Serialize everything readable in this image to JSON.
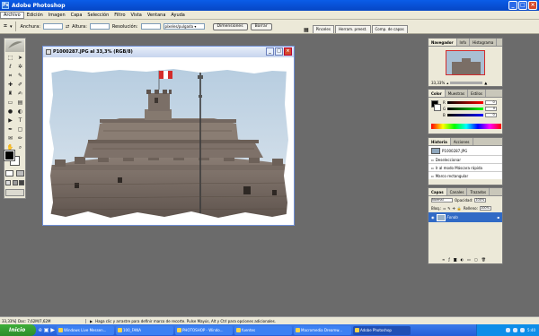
{
  "app": {
    "title": "Adobe Photoshop",
    "icon": "Ps"
  },
  "menu": [
    "Archivo",
    "Edición",
    "Imagen",
    "Capa",
    "Selección",
    "Filtro",
    "Vista",
    "Ventana",
    "Ayuda"
  ],
  "options": {
    "width_label": "Anchura:",
    "height_label": "Altura:",
    "resolution_label": "Resolución:",
    "units_select": "píxeles/pulgada",
    "front_image_button": "Dimensiones",
    "clear_button": "Borrar"
  },
  "palette_well": [
    "Pinceles",
    "Herram. preest.",
    "Comp. de capas"
  ],
  "document": {
    "title": "P1000287.JPG al 33,3% (RGB/8)"
  },
  "navigator": {
    "tabs": [
      "Navegador",
      "Info",
      "Histograma"
    ],
    "zoom": "33,33%"
  },
  "color": {
    "tabs": [
      "Color",
      "Muestras",
      "Estilos"
    ],
    "channels": [
      {
        "label": "R",
        "value": "0"
      },
      {
        "label": "G",
        "value": "0"
      },
      {
        "label": "B",
        "value": "0"
      }
    ]
  },
  "history": {
    "tabs": [
      "Historia",
      "Acciones"
    ],
    "snapshot": "P1000287.JPG",
    "steps": [
      "Deseleccionar",
      "Ir al modo Máscara rápida",
      "Marco rectangular"
    ]
  },
  "layers": {
    "tabs": [
      "Capas",
      "Canales",
      "Trazados"
    ],
    "blend_mode": "Normal",
    "opacity_label": "Opacidad:",
    "opacity": "100%",
    "lock_label": "Bloq.:",
    "fill_label": "Relleno:",
    "fill": "100%",
    "layer_name": "Fondo"
  },
  "status": {
    "zoom": "33,33%",
    "doc_size": "Doc: 7,62M/7,62M",
    "hint": "Haga clic y arrastre para definir marco de recorte. Pulse Mayús, Alt y Ctrl para opciones adicionales."
  },
  "taskbar": {
    "start": "Inicio",
    "tasks": [
      "Windows Live Messen...",
      "100_FANA",
      "PHOTOSHOP - Windo...",
      "fuentes",
      "Macromedia Dreamw...",
      "Adobe Photoshop"
    ],
    "time": "5:40"
  },
  "colors": {
    "titlebar": "#0a5de8",
    "taskbar": "#245ed8",
    "workspace": "#6b6b6b",
    "flag_red": "#d22c2c"
  }
}
